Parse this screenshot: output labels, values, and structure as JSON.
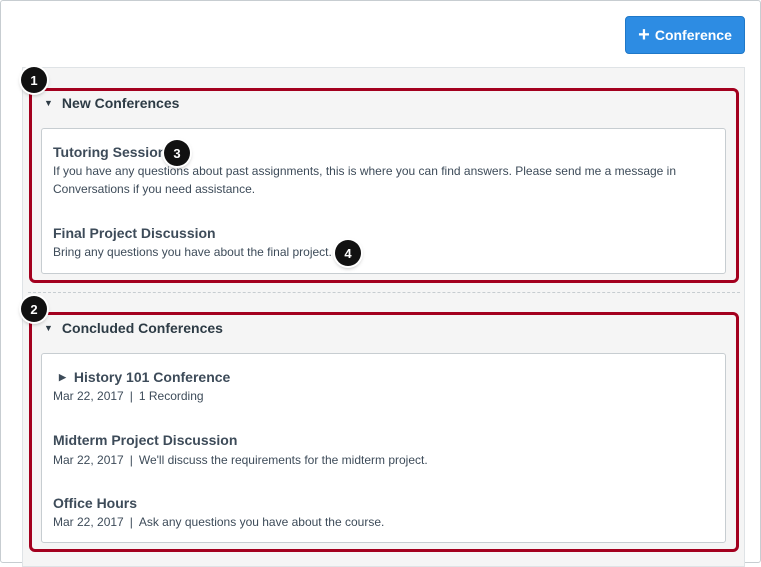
{
  "toolbar": {
    "add_icon": "plus-icon",
    "add_label": "Conference"
  },
  "new_section": {
    "title": "New Conferences",
    "items": [
      {
        "title": "Tutoring Session",
        "description": "If you have any questions about past assignments, this is where you can find answers. Please send me a message in Conversations if you need assistance."
      },
      {
        "title": "Final Project Discussion",
        "description": "Bring any questions you have about the final project."
      }
    ]
  },
  "concluded_section": {
    "title": "Concluded Conferences",
    "items": [
      {
        "title": "History 101 Conference",
        "date": "Mar 22, 2017",
        "separator": "|",
        "detail": "1 Recording"
      },
      {
        "title": "Midterm Project Discussion",
        "date": "Mar 22, 2017",
        "separator": "|",
        "detail": "We'll discuss the requirements for the midterm project."
      },
      {
        "title": "Office Hours",
        "date": "Mar 22, 2017",
        "separator": "|",
        "detail": "Ask any questions you have about the course."
      }
    ]
  },
  "callouts": [
    "1",
    "2",
    "3",
    "4"
  ],
  "colors": {
    "accent": "#2d8ce3",
    "highlight": "#a3001e",
    "text": "#2d3b45"
  }
}
